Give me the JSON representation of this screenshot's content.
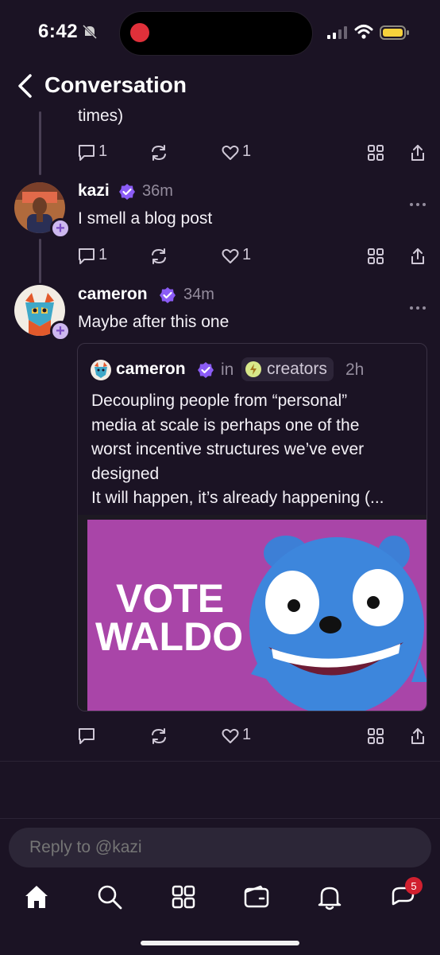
{
  "status_bar": {
    "time": "6:42"
  },
  "header": {
    "title": "Conversation"
  },
  "top_post": {
    "text_tail": "times)",
    "reply_count": "1",
    "like_count": "1"
  },
  "kazi_post": {
    "author": "kazi",
    "time": "36m",
    "text": "I smell a blog post",
    "reply_count": "1",
    "like_count": "1"
  },
  "cameron_post": {
    "author": "cameron",
    "time": "34m",
    "text": "Maybe after this one",
    "like_count": "1"
  },
  "quote": {
    "author": "cameron",
    "in_label": "in",
    "channel": "creators",
    "time": "2h",
    "lines": [
      "Decoupling people from “personal”",
      "media at scale is perhaps one of the",
      "worst incentive structures we’ve ever",
      "designed",
      "It will happen, it’s already happening (..."
    ],
    "image_text_line1": "VOTE",
    "image_text_line2": "WALDO"
  },
  "reply": {
    "placeholder": "Reply to @kazi"
  },
  "tab_bar": {
    "notification_badge": "5"
  },
  "colors": {
    "accent": "#8b5cf6",
    "background": "#1b1324",
    "badge": "#d1202f"
  }
}
